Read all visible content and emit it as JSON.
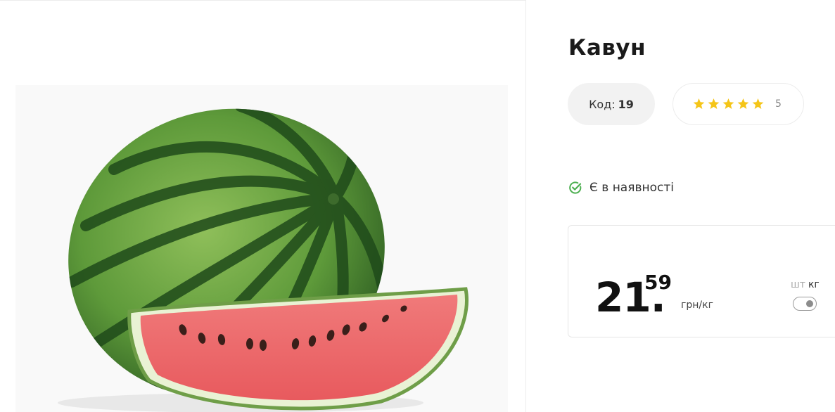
{
  "product": {
    "title": "Кавун",
    "image_alt": "watermelon-photo",
    "code_label": "Код:",
    "code_value": "19",
    "rating": {
      "stars": 5,
      "count": "5",
      "star_color": "#f5c518"
    },
    "stock": {
      "text": "Є в наявності",
      "icon": "check-circle-icon",
      "color": "#4caf50"
    },
    "price": {
      "integer": "21.",
      "decimal": "59",
      "unit": "грн/кг"
    },
    "unit_switch": {
      "option_pcs": "шт",
      "option_kg": "кг",
      "selected": "кг"
    }
  }
}
